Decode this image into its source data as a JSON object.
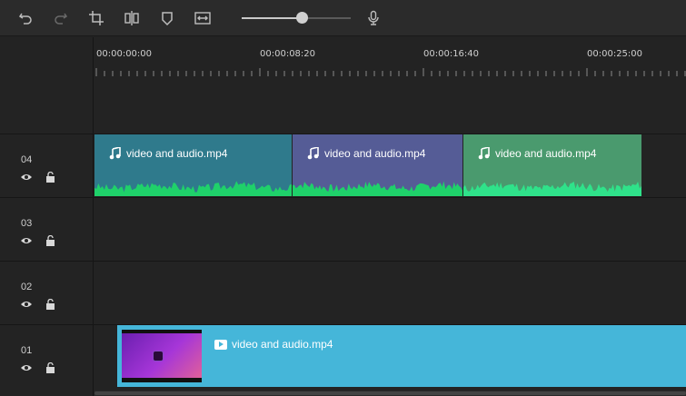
{
  "toolbar": {
    "buttons": [
      {
        "icon": "undo-icon"
      },
      {
        "icon": "redo-icon"
      },
      {
        "icon": "crop-icon"
      },
      {
        "icon": "split-icon"
      },
      {
        "icon": "shield-icon"
      },
      {
        "icon": "fit-width-icon"
      }
    ],
    "zoom_level": 0.55,
    "mic_icon": "microphone-icon"
  },
  "ruler": {
    "labels": [
      "00:00:00:00",
      "00:00:08:20",
      "00:00:16:40",
      "00:00:25:00"
    ]
  },
  "tracks": [
    {
      "number": "04"
    },
    {
      "number": "03"
    },
    {
      "number": "02"
    },
    {
      "number": "01"
    }
  ],
  "audio_clips": [
    {
      "title": "video and audio.mp4",
      "color": "#2f7a8c"
    },
    {
      "title": "video and audio.mp4",
      "color": "#555c96"
    },
    {
      "title": "video and audio.mp4",
      "color": "#4a9a6e"
    }
  ],
  "video_clip": {
    "title": "video and audio.mp4",
    "color": "#45b6d9"
  },
  "colors": {
    "waveform": "#1fd16a",
    "waveform_alt": "#2fe28a"
  }
}
